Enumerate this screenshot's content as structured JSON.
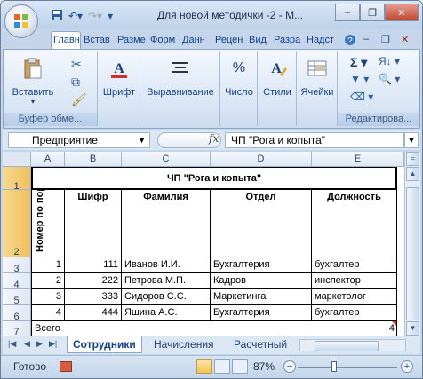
{
  "window": {
    "title": "Для новой методички -2 - M...",
    "minimize_glyph": "–",
    "restore_glyph": "❐",
    "close_glyph": "✕"
  },
  "ribbon_tabs": [
    "Главн",
    "Встав",
    "Разме",
    "Форм",
    "Данн",
    "Рецен",
    "Вид",
    "Разра",
    "Надст"
  ],
  "ribbon": {
    "paste_label": "Вставить",
    "clipboard_label": "Буфер обме...",
    "font_label": "Шрифт",
    "alignment_label": "Выравнивание",
    "number_label": "Число",
    "styles_label": "Стили",
    "cells_label": "Ячейки",
    "editing_label": "Редактирова..."
  },
  "formula_bar": {
    "name_box": "Предприятие",
    "fx": "fx",
    "content": "ЧП \"Рога и копыта\""
  },
  "columns": [
    "A",
    "B",
    "C",
    "D",
    "E"
  ],
  "rows": [
    "1",
    "2",
    "3",
    "4",
    "5",
    "6",
    "7"
  ],
  "sheet": {
    "title": "ЧП \"Рога и копыта\"",
    "headers": {
      "num": "Номер по порядку",
      "cipher": "Шифр",
      "surname": "Фамилия",
      "department": "Отдел",
      "position": "Должность"
    },
    "records": [
      {
        "num": "1",
        "cipher": "111",
        "surname": "Иванов И.И.",
        "department": "Бухгалтерия",
        "position": "бухгалтер"
      },
      {
        "num": "2",
        "cipher": "222",
        "surname": "Петрова М.П.",
        "department": "Кадров",
        "position": "инспектор"
      },
      {
        "num": "3",
        "cipher": "333",
        "surname": "Сидоров С.С.",
        "department": "Маркетинга",
        "position": "маркетолог"
      },
      {
        "num": "4",
        "cipher": "444",
        "surname": "Яшина А.С.",
        "department": "Бухгалтерия",
        "position": "бухгалтер"
      }
    ],
    "total_label": "Всего",
    "total_value": "4"
  },
  "sheet_tabs": [
    "Сотрудники",
    "Начисления",
    "Расчетный"
  ],
  "status": {
    "ready": "Готово",
    "zoom": "87%",
    "zoom_fraction": 0.87
  },
  "colors": {
    "accent": "#15428b",
    "selected_header": "#f1bf5e"
  }
}
